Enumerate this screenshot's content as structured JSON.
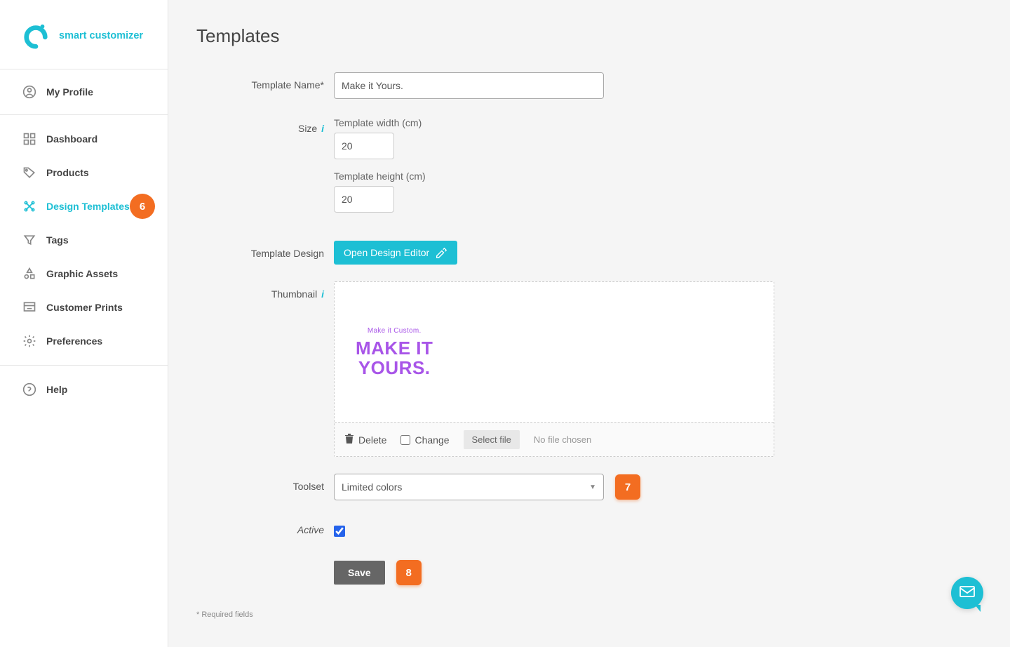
{
  "brand": "smart customizer",
  "sidebar": {
    "profile": "My Profile",
    "items": [
      {
        "label": "Dashboard"
      },
      {
        "label": "Products"
      },
      {
        "label": "Design Templates",
        "badge": "6",
        "active": true
      },
      {
        "label": "Tags"
      },
      {
        "label": "Graphic Assets"
      },
      {
        "label": "Customer Prints"
      },
      {
        "label": "Preferences"
      }
    ],
    "help": "Help"
  },
  "page": {
    "title": "Templates",
    "labels": {
      "template_name": "Template Name*",
      "size": "Size",
      "width": "Template width (cm)",
      "height": "Template height (cm)",
      "template_design": "Template Design",
      "thumbnail": "Thumbnail",
      "toolset": "Toolset",
      "active": "Active"
    },
    "values": {
      "template_name": "Make it Yours.",
      "width": "20",
      "height": "20",
      "toolset": "Limited colors",
      "active_checked": true
    },
    "buttons": {
      "open_editor": "Open Design Editor",
      "delete": "Delete",
      "change": "Change",
      "select_file": "Select file",
      "no_file": "No file chosen",
      "save": "Save"
    },
    "preview": {
      "small": "Make it Custom.",
      "big1": "MAKE IT",
      "big2": "YOURS."
    },
    "markers": {
      "toolset": "7",
      "save": "8"
    },
    "required_note": "* Required fields"
  }
}
